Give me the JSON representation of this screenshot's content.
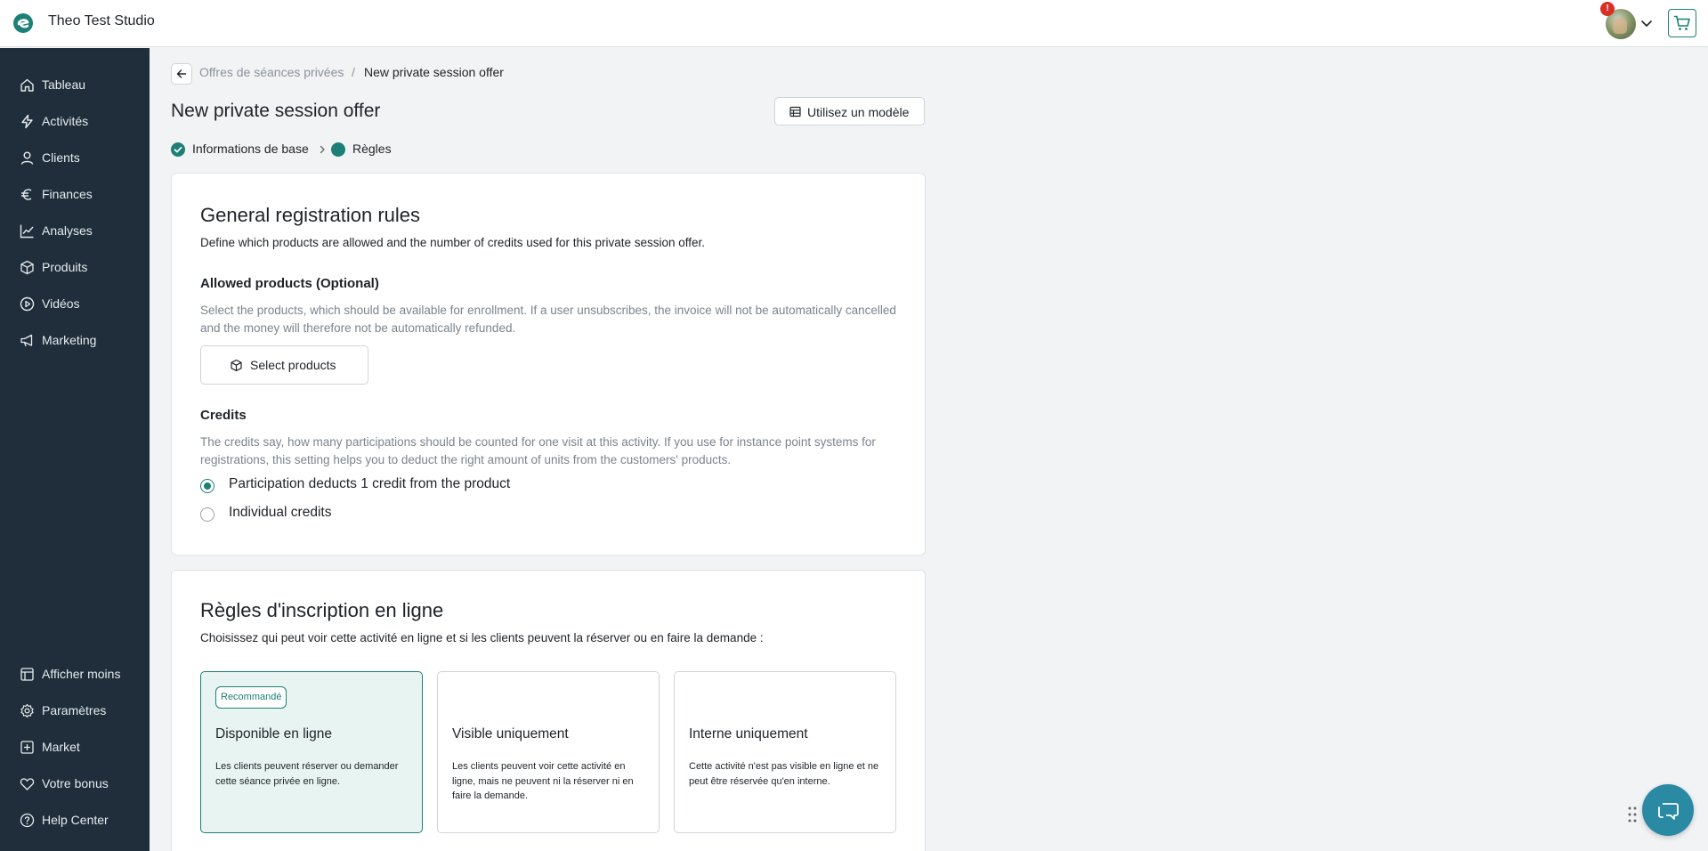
{
  "app": {
    "title": "Theo Test Studio",
    "notification_count": "!"
  },
  "sidebar": {
    "items": [
      {
        "label": "Tableau",
        "icon": "home-icon"
      },
      {
        "label": "Activités",
        "icon": "lightning-icon"
      },
      {
        "label": "Clients",
        "icon": "user-icon"
      },
      {
        "label": "Finances",
        "icon": "euro-icon"
      },
      {
        "label": "Analyses",
        "icon": "chart-line-icon"
      },
      {
        "label": "Produits",
        "icon": "box-icon"
      },
      {
        "label": "Vidéos",
        "icon": "play-circle-icon"
      },
      {
        "label": "Marketing",
        "icon": "megaphone-icon"
      }
    ],
    "bottom_items": [
      {
        "label": "Afficher moins",
        "icon": "collapse-icon"
      },
      {
        "label": "Paramètres",
        "icon": "gear-icon"
      },
      {
        "label": "Market",
        "icon": "plus-square-icon"
      },
      {
        "label": "Votre bonus",
        "icon": "heart-icon"
      },
      {
        "label": "Help Center",
        "icon": "help-circle-icon"
      }
    ]
  },
  "breadcrumb": {
    "parent": "Offres de séances privées",
    "separator": "/",
    "current": "New private session offer"
  },
  "page": {
    "title": "New private session offer",
    "template_button": "Utilisez un modèle"
  },
  "steps": {
    "step1": "Informations de base",
    "step2": "Règles"
  },
  "general_rules": {
    "title": "General registration rules",
    "description": "Define which products are allowed and the number of credits used for this private session offer.",
    "allowed_products_title": "Allowed products (Optional)",
    "allowed_products_help": "Select the products, which should be available for enrollment. If a user unsubscribes, the invoice will not be automatically cancelled and the money will therefore not be automatically refunded.",
    "select_products_label": "Select products",
    "credits_title": "Credits",
    "credits_help": "The credits say, how many participations should be counted for one visit at this activity. If you use for instance point systems for registrations, this setting helps you to deduct the right amount of units from the customers' products.",
    "option_deduct": "Participation deducts 1 credit from the product",
    "option_individual": "Individual credits",
    "selected_option": "deduct"
  },
  "online_rules": {
    "title": "Règles d'inscription en ligne",
    "description": "Choisissez qui peut voir cette activité en ligne et si les clients peuvent la réserver ou en faire la demande :",
    "options": [
      {
        "badge": "Recommandé",
        "title": "Disponible en ligne",
        "text": "Les clients peuvent réserver ou demander cette séance privée en ligne.",
        "selected": true
      },
      {
        "badge": "",
        "title": "Visible uniquement",
        "text": "Les clients peuvent voir cette activité en ligne, mais ne peuvent ni la réserver ni en faire la demande.",
        "selected": false
      },
      {
        "badge": "",
        "title": "Interne uniquement",
        "text": "Cette activité n'est pas visible en ligne et ne peut être réservée qu'en interne.",
        "selected": false
      }
    ]
  },
  "colors": {
    "accent": "#1d7f76",
    "sidebar_bg": "#1f2e3a",
    "chat_bg": "#2a8aa3",
    "page_bg": "#f2f3f5"
  }
}
